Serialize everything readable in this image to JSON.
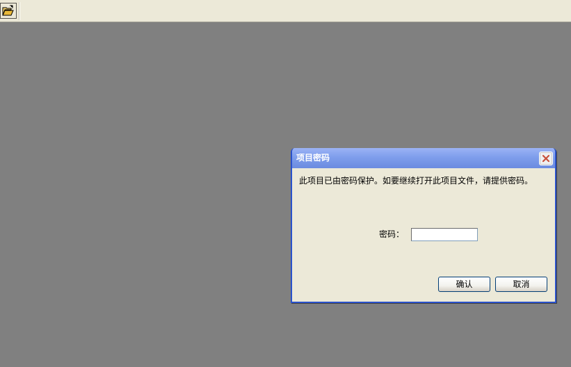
{
  "toolbar": {
    "open_icon": "open-folder-icon"
  },
  "dialog": {
    "title": "项目密码",
    "close_icon": "close-icon",
    "message": "此项目已由密码保护。如要继续打开此项目文件，请提供密码。",
    "password_label": "密码：",
    "password_value": "",
    "ok_label": "确认",
    "cancel_label": "取消",
    "colors": {
      "title_bar": "#7f9eec",
      "close_x": "#c8503b",
      "workspace": "#808080",
      "dialog_bg": "#ece9d8"
    }
  }
}
